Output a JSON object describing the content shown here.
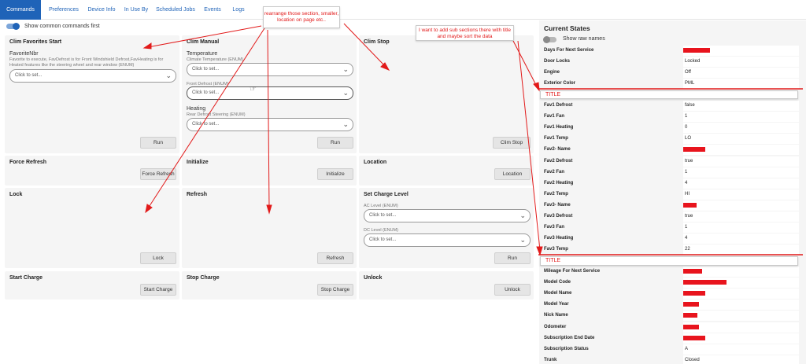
{
  "tabs": [
    "Commands",
    "Preferences",
    "Device Info",
    "In Use By",
    "Scheduled Jobs",
    "Events",
    "Logs"
  ],
  "commands": {
    "show_common_label": "Show common commands first",
    "select_placeholder": "Click to set...",
    "clim_fav": {
      "title": "Clim Favorites Start",
      "field_label": "FavoriteNbr",
      "field_hint": "Favorite to execute, FavDefrost is for Front Windshield Defrost,FavHeating is for Heated features like the steering wheel and rear window (ENUM)",
      "button": "Run"
    },
    "clim_manual": {
      "title": "Clim Manual",
      "temperature_label": "Temperature",
      "temperature_hint": "Climate Temperature (ENUM)",
      "front_defrost_hint": "Front Defrost (ENUM)",
      "heating_label": "Heating",
      "heating_hint": "Rear Defrost Steering (ENUM)",
      "button": "Run"
    },
    "clim_stop": {
      "title": "Clim Stop",
      "button": "Clim Stop"
    },
    "force_refresh": {
      "title": "Force Refresh",
      "button": "Force Refresh"
    },
    "initialize": {
      "title": "Initialize",
      "button": "Initialize"
    },
    "location": {
      "title": "Location",
      "button": "Location"
    },
    "lock": {
      "title": "Lock",
      "button": "Lock"
    },
    "refresh": {
      "title": "Refresh",
      "button": "Refresh"
    },
    "charge_level": {
      "title": "Set Charge Level",
      "ac_hint": "AC Level (ENUM)",
      "dc_hint": "DC Level (ENUM)",
      "button": "Run"
    },
    "start_charge": {
      "title": "Start Charge",
      "button": "Start Charge"
    },
    "stop_charge": {
      "title": "Stop Charge",
      "button": "Stop Charge"
    },
    "unlock": {
      "title": "Unlock",
      "button": "Unlock"
    }
  },
  "states": {
    "title": "Current States",
    "raw_names_label": "Show raw names",
    "rows": [
      {
        "name": "Days For Next Service",
        "value": ""
      },
      {
        "name": "Door Locks",
        "value": "Locked"
      },
      {
        "name": "Engine",
        "value": "Off"
      },
      {
        "name": "Exterior Color",
        "value": "PML"
      },
      {
        "name": "Fav1 Defrost",
        "value": "false"
      },
      {
        "name": "Fav1 Fan",
        "value": "1"
      },
      {
        "name": "Fav1 Heating",
        "value": "0"
      },
      {
        "name": "Fav1 Temp",
        "value": "LO"
      },
      {
        "name": "Fav2- Name",
        "value": ""
      },
      {
        "name": "Fav2 Defrost",
        "value": "true"
      },
      {
        "name": "Fav2 Fan",
        "value": "1"
      },
      {
        "name": "Fav2 Heating",
        "value": "4"
      },
      {
        "name": "Fav2 Temp",
        "value": "HI"
      },
      {
        "name": "Fav3- Name",
        "value": ""
      },
      {
        "name": "Fav3 Defrost",
        "value": "true"
      },
      {
        "name": "Fav3 Fan",
        "value": "1"
      },
      {
        "name": "Fav3 Heating",
        "value": "4"
      },
      {
        "name": "Fav3 Temp",
        "value": "22"
      },
      {
        "name": "Mileage For Next Service",
        "value": ""
      },
      {
        "name": "Model Code",
        "value": ""
      },
      {
        "name": "Model Name",
        "value": ""
      },
      {
        "name": "Model Year",
        "value": ""
      },
      {
        "name": "Nick Name",
        "value": ""
      },
      {
        "name": "Odometer",
        "value": ""
      },
      {
        "name": "Subscription End Date",
        "value": ""
      },
      {
        "name": "Subscription Status",
        "value": "A"
      },
      {
        "name": "Trunk",
        "value": "Closed"
      }
    ]
  },
  "annotations": {
    "note_left": "rearrange those section, smaller, location on page etc..",
    "note_right": "I want to add sub sections there with title and maybe sort the data",
    "title_1": "TITLE",
    "title_2": "TITLE"
  },
  "colors": {
    "accent": "#1f63b8",
    "annotation": "#e21a1a",
    "card_bg": "#f5f5f5"
  }
}
